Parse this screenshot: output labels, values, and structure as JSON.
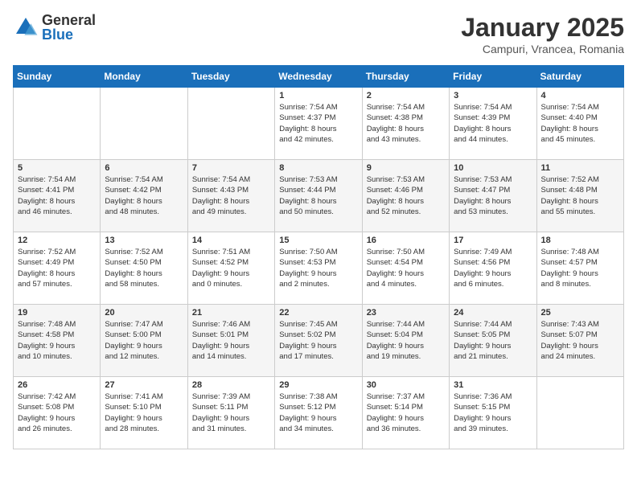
{
  "logo": {
    "general": "General",
    "blue": "Blue"
  },
  "title": "January 2025",
  "location": "Campuri, Vrancea, Romania",
  "days_of_week": [
    "Sunday",
    "Monday",
    "Tuesday",
    "Wednesday",
    "Thursday",
    "Friday",
    "Saturday"
  ],
  "weeks": [
    [
      {
        "day": "",
        "info": ""
      },
      {
        "day": "",
        "info": ""
      },
      {
        "day": "",
        "info": ""
      },
      {
        "day": "1",
        "info": "Sunrise: 7:54 AM\nSunset: 4:37 PM\nDaylight: 8 hours\nand 42 minutes."
      },
      {
        "day": "2",
        "info": "Sunrise: 7:54 AM\nSunset: 4:38 PM\nDaylight: 8 hours\nand 43 minutes."
      },
      {
        "day": "3",
        "info": "Sunrise: 7:54 AM\nSunset: 4:39 PM\nDaylight: 8 hours\nand 44 minutes."
      },
      {
        "day": "4",
        "info": "Sunrise: 7:54 AM\nSunset: 4:40 PM\nDaylight: 8 hours\nand 45 minutes."
      }
    ],
    [
      {
        "day": "5",
        "info": "Sunrise: 7:54 AM\nSunset: 4:41 PM\nDaylight: 8 hours\nand 46 minutes."
      },
      {
        "day": "6",
        "info": "Sunrise: 7:54 AM\nSunset: 4:42 PM\nDaylight: 8 hours\nand 48 minutes."
      },
      {
        "day": "7",
        "info": "Sunrise: 7:54 AM\nSunset: 4:43 PM\nDaylight: 8 hours\nand 49 minutes."
      },
      {
        "day": "8",
        "info": "Sunrise: 7:53 AM\nSunset: 4:44 PM\nDaylight: 8 hours\nand 50 minutes."
      },
      {
        "day": "9",
        "info": "Sunrise: 7:53 AM\nSunset: 4:46 PM\nDaylight: 8 hours\nand 52 minutes."
      },
      {
        "day": "10",
        "info": "Sunrise: 7:53 AM\nSunset: 4:47 PM\nDaylight: 8 hours\nand 53 minutes."
      },
      {
        "day": "11",
        "info": "Sunrise: 7:52 AM\nSunset: 4:48 PM\nDaylight: 8 hours\nand 55 minutes."
      }
    ],
    [
      {
        "day": "12",
        "info": "Sunrise: 7:52 AM\nSunset: 4:49 PM\nDaylight: 8 hours\nand 57 minutes."
      },
      {
        "day": "13",
        "info": "Sunrise: 7:52 AM\nSunset: 4:50 PM\nDaylight: 8 hours\nand 58 minutes."
      },
      {
        "day": "14",
        "info": "Sunrise: 7:51 AM\nSunset: 4:52 PM\nDaylight: 9 hours\nand 0 minutes."
      },
      {
        "day": "15",
        "info": "Sunrise: 7:50 AM\nSunset: 4:53 PM\nDaylight: 9 hours\nand 2 minutes."
      },
      {
        "day": "16",
        "info": "Sunrise: 7:50 AM\nSunset: 4:54 PM\nDaylight: 9 hours\nand 4 minutes."
      },
      {
        "day": "17",
        "info": "Sunrise: 7:49 AM\nSunset: 4:56 PM\nDaylight: 9 hours\nand 6 minutes."
      },
      {
        "day": "18",
        "info": "Sunrise: 7:48 AM\nSunset: 4:57 PM\nDaylight: 9 hours\nand 8 minutes."
      }
    ],
    [
      {
        "day": "19",
        "info": "Sunrise: 7:48 AM\nSunset: 4:58 PM\nDaylight: 9 hours\nand 10 minutes."
      },
      {
        "day": "20",
        "info": "Sunrise: 7:47 AM\nSunset: 5:00 PM\nDaylight: 9 hours\nand 12 minutes."
      },
      {
        "day": "21",
        "info": "Sunrise: 7:46 AM\nSunset: 5:01 PM\nDaylight: 9 hours\nand 14 minutes."
      },
      {
        "day": "22",
        "info": "Sunrise: 7:45 AM\nSunset: 5:02 PM\nDaylight: 9 hours\nand 17 minutes."
      },
      {
        "day": "23",
        "info": "Sunrise: 7:44 AM\nSunset: 5:04 PM\nDaylight: 9 hours\nand 19 minutes."
      },
      {
        "day": "24",
        "info": "Sunrise: 7:44 AM\nSunset: 5:05 PM\nDaylight: 9 hours\nand 21 minutes."
      },
      {
        "day": "25",
        "info": "Sunrise: 7:43 AM\nSunset: 5:07 PM\nDaylight: 9 hours\nand 24 minutes."
      }
    ],
    [
      {
        "day": "26",
        "info": "Sunrise: 7:42 AM\nSunset: 5:08 PM\nDaylight: 9 hours\nand 26 minutes."
      },
      {
        "day": "27",
        "info": "Sunrise: 7:41 AM\nSunset: 5:10 PM\nDaylight: 9 hours\nand 28 minutes."
      },
      {
        "day": "28",
        "info": "Sunrise: 7:39 AM\nSunset: 5:11 PM\nDaylight: 9 hours\nand 31 minutes."
      },
      {
        "day": "29",
        "info": "Sunrise: 7:38 AM\nSunset: 5:12 PM\nDaylight: 9 hours\nand 34 minutes."
      },
      {
        "day": "30",
        "info": "Sunrise: 7:37 AM\nSunset: 5:14 PM\nDaylight: 9 hours\nand 36 minutes."
      },
      {
        "day": "31",
        "info": "Sunrise: 7:36 AM\nSunset: 5:15 PM\nDaylight: 9 hours\nand 39 minutes."
      },
      {
        "day": "",
        "info": ""
      }
    ]
  ]
}
